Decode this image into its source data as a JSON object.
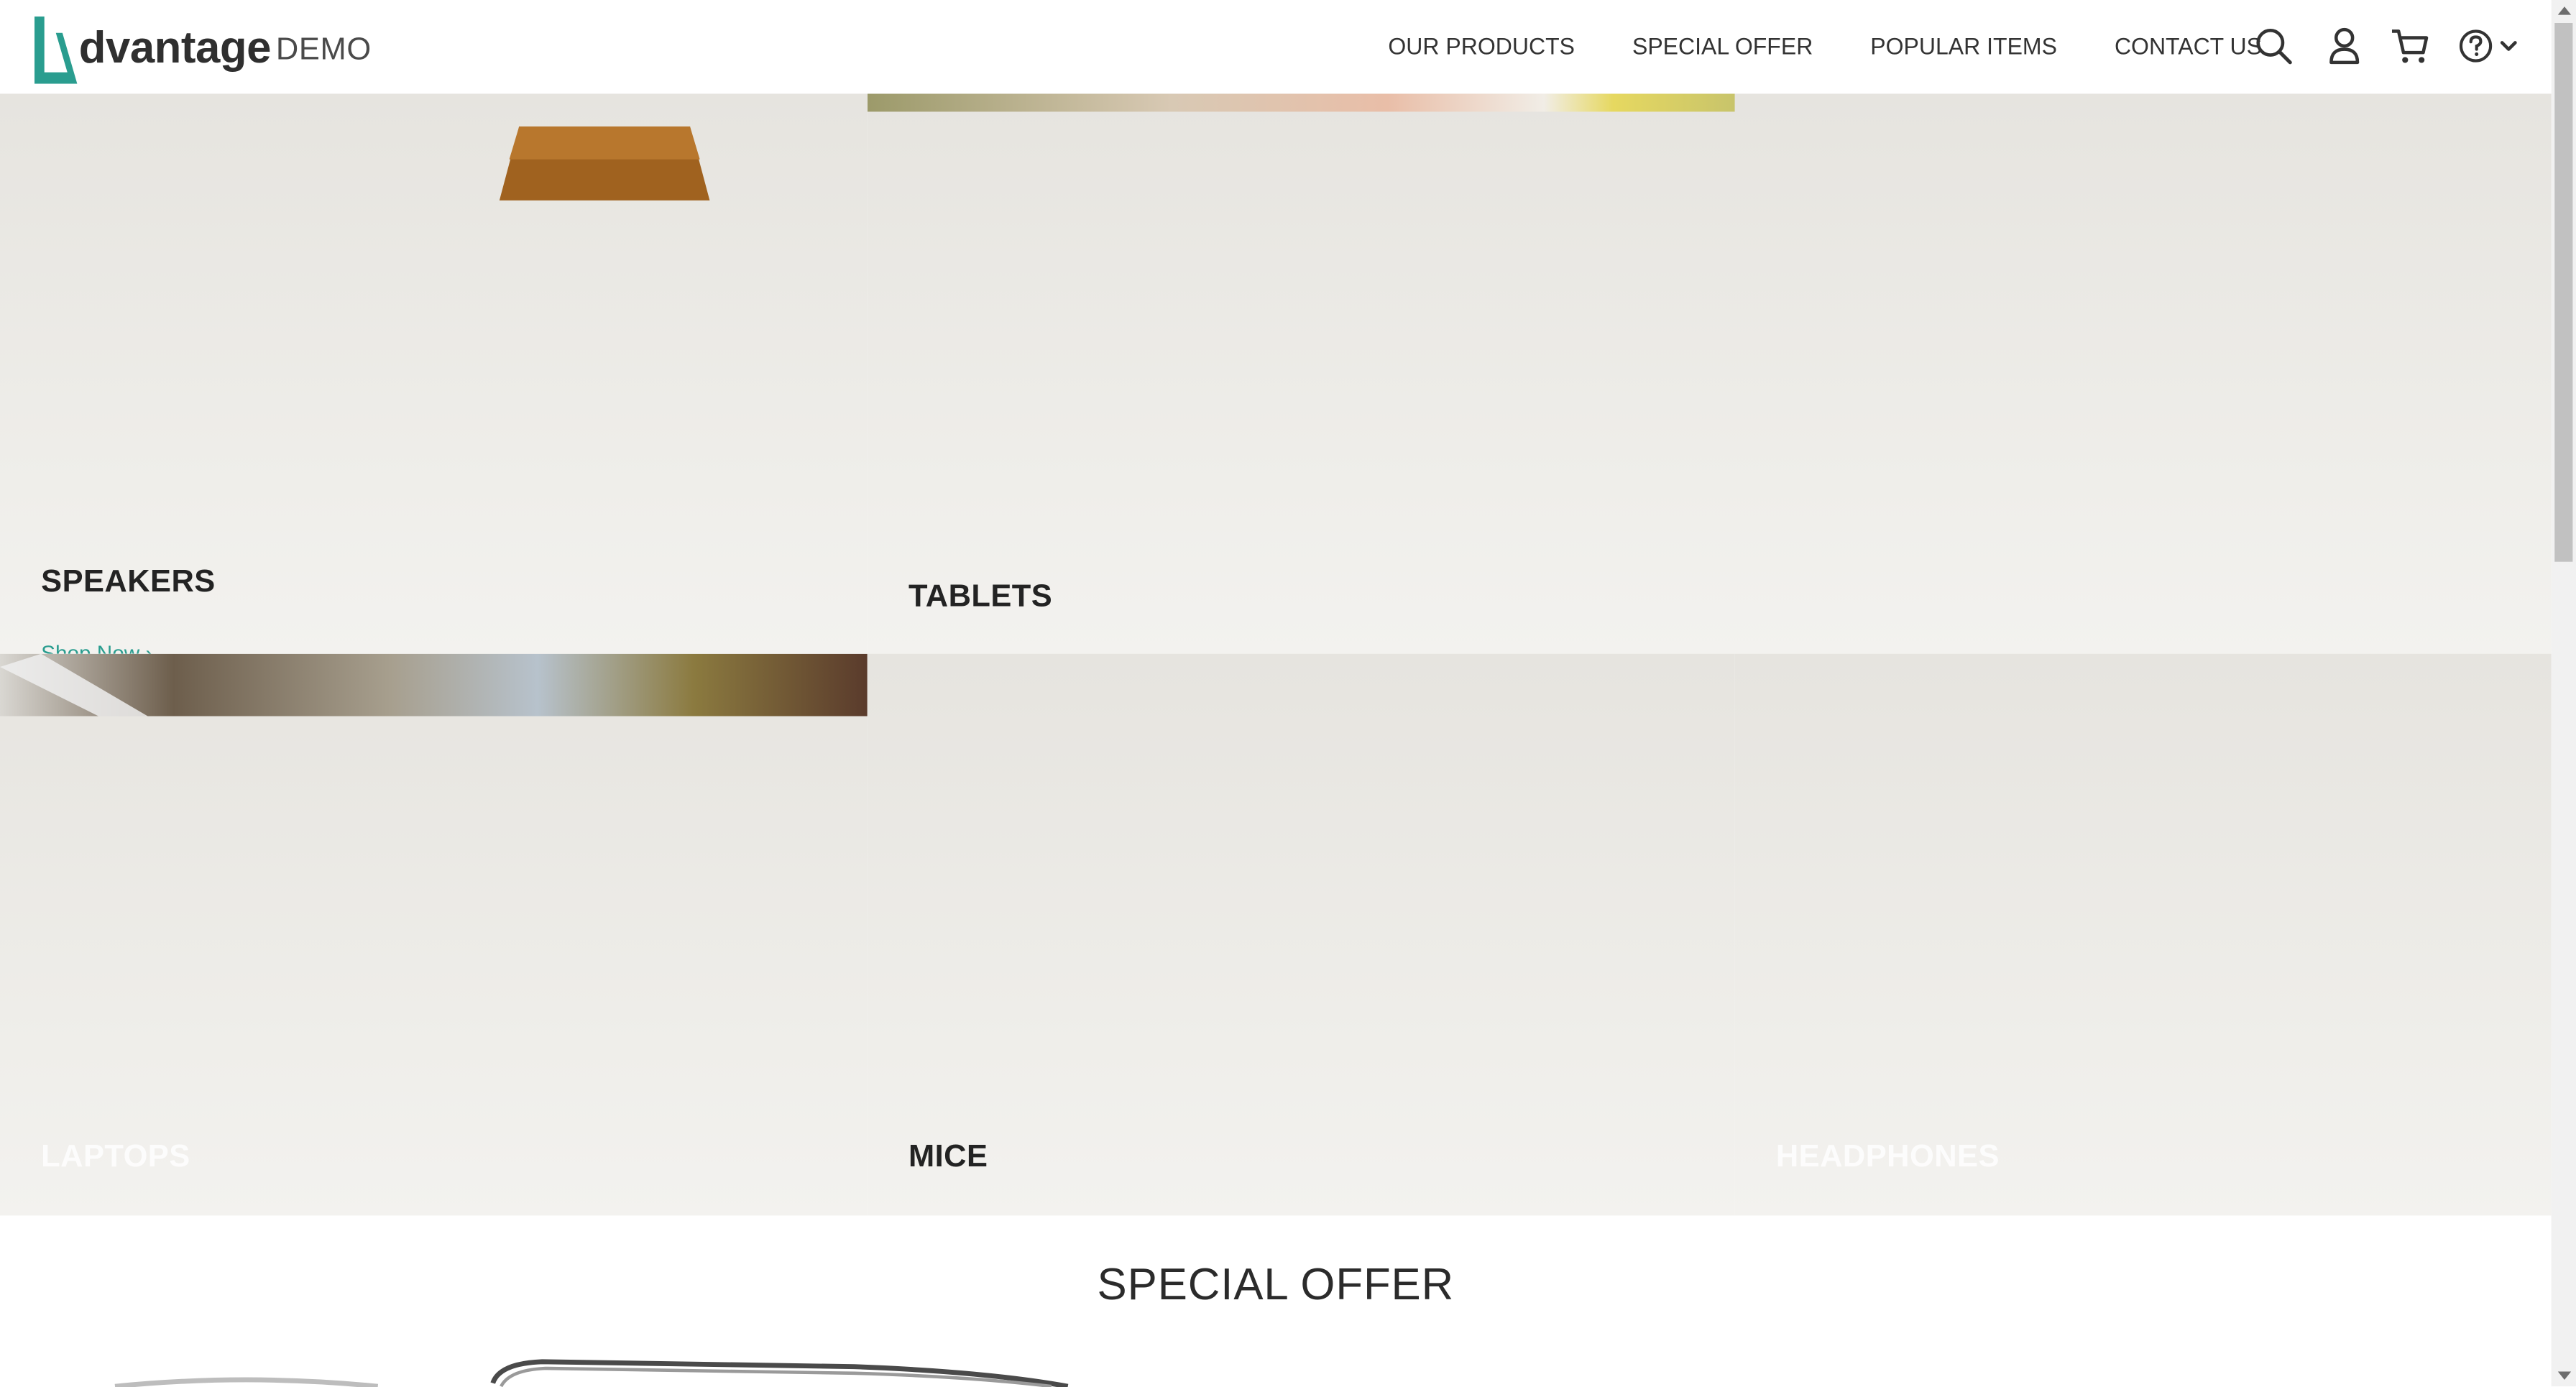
{
  "logo": {
    "wordmark": "dvantage",
    "suffix": "DEMO",
    "accent_color": "#2a9d8f"
  },
  "nav": {
    "items": [
      "OUR PRODUCTS",
      "SPECIAL OFFER",
      "POPULAR ITEMS",
      "CONTACT US"
    ]
  },
  "header_icons": [
    "search-icon",
    "user-icon",
    "cart-icon",
    "help-icon",
    "chevron-down-icon"
  ],
  "categories": {
    "speakers": {
      "title": "SPEAKERS",
      "link": "Shop Now"
    },
    "tablets": {
      "title": "TABLETS"
    },
    "laptops": {
      "title": "LAPTOPS"
    },
    "mice": {
      "title": "MICE"
    },
    "headphones": {
      "title": "HEADPHONES"
    }
  },
  "special_offer": {
    "title": "SPECIAL OFFER"
  }
}
